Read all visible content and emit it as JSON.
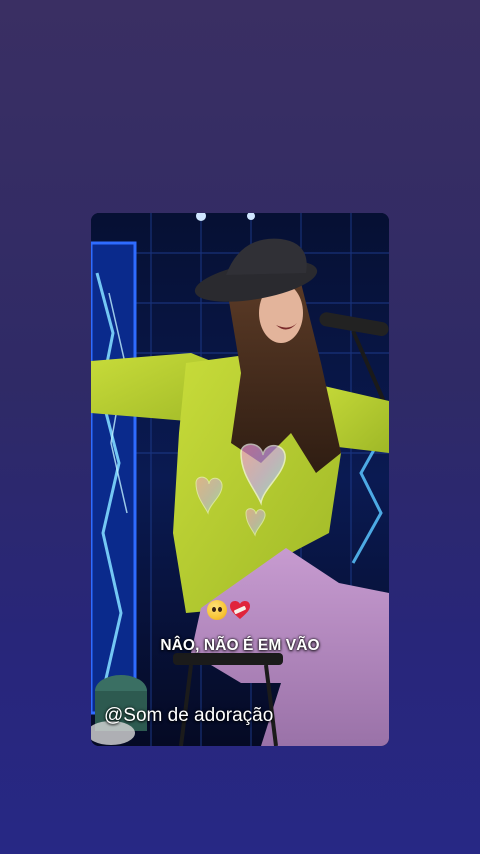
{
  "story": {
    "caption": "NÂO, NÃO É EM VÃO",
    "handle": "@Som de adoração",
    "emojis": [
      "pleading-face-icon",
      "mending-heart-icon"
    ]
  },
  "colors": {
    "background_top": "#3a2f63",
    "background_bottom": "#272885",
    "caption_text": "#ffffff"
  }
}
